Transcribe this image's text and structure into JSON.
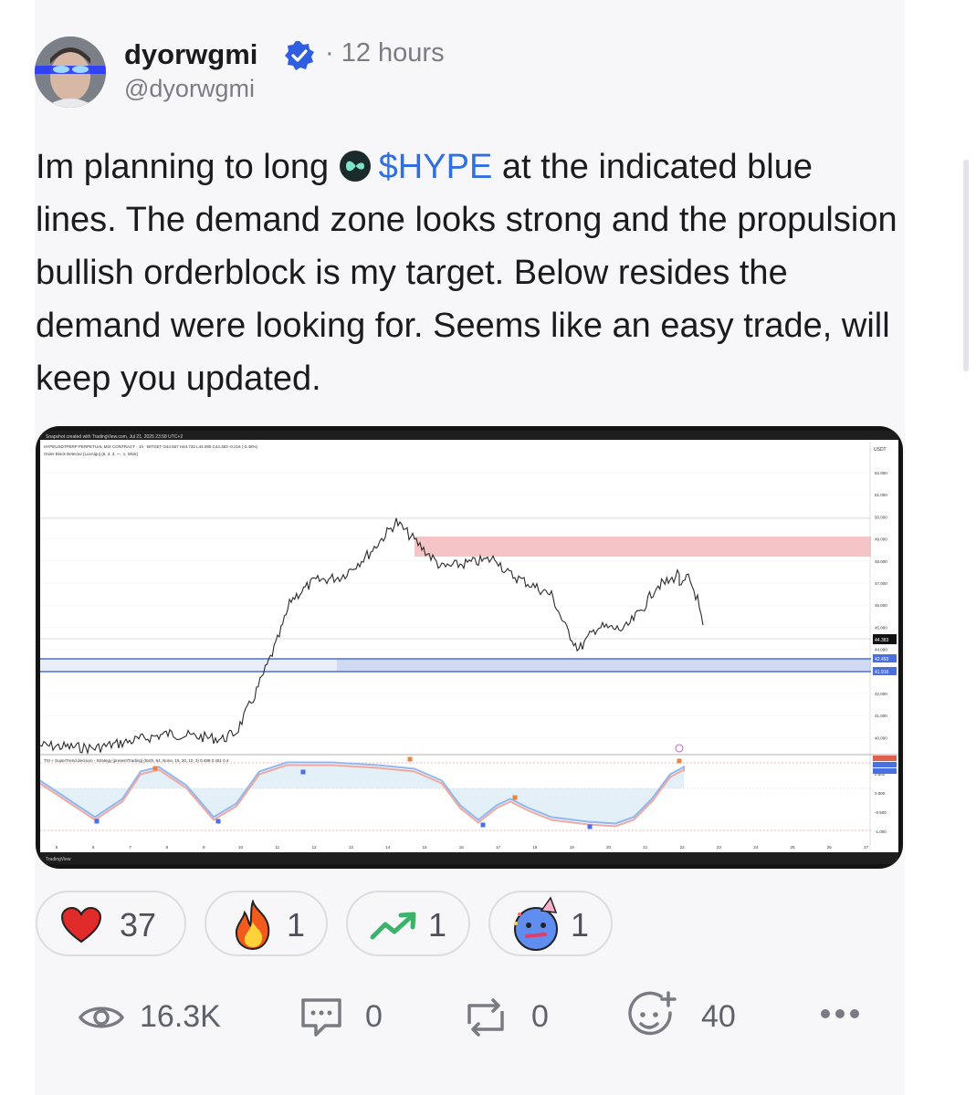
{
  "author": {
    "name": "dyorwgmi",
    "handle": "@dyorwgmi",
    "time": "· 12 hours",
    "verified": true
  },
  "post": {
    "text_before": "Im planning to long",
    "ticker": "$HYPE",
    "text_after": " at the indicated blue lines. The demand zone looks strong and the propulsion bullish orderblock is my target. Below resides the demand were looking for. Seems like an easy trade, will keep you updated.",
    "ticker_color": "#2f6fe0",
    "coin_icon": "hyperliquid-icon"
  },
  "chart_image": {
    "header": "Snapshot created with TradingView.com, Jul 21, 2025 23:58 UTC+2",
    "symbol_line": "HYPEUSDTPERP PERPETUAL MIX CONTRACT · 1h · BITGET O44.567 H44.732 L44.085 C44.383 -0.216 (-0.48%)",
    "indicator_line": "Order Block Detector [LuxAlgo] (5, 3, 3, —, 1, Wick)",
    "oscillator_line": "TSI + SuperTrend decision - Strategy [presentTrading] (Both, 64, None, 16, 20, 10, 3) 0.498 0.451 0.4",
    "currency": "USDT",
    "price_ticks": [
      "52.000",
      "51.000",
      "50.000",
      "49.000",
      "48.000",
      "47.000",
      "46.000",
      "45.000",
      "44.000",
      "43.000",
      "42.000",
      "41.000",
      "40.000"
    ],
    "price_badge": "44.383",
    "blue_badge_1": "42.493",
    "blue_badge_2": "41.916",
    "osc_ticks": [
      "0.500",
      "0.000",
      "-0.500",
      "-1.000"
    ],
    "date_ticks": [
      "5",
      "6",
      "7",
      "8",
      "9",
      "10",
      "11",
      "12",
      "13",
      "14",
      "15",
      "16",
      "17",
      "18",
      "19",
      "20",
      "21",
      "22",
      "23",
      "24",
      "25",
      "26",
      "27"
    ],
    "watermark": "TradingView",
    "demand_zone_color": "#aabbe8",
    "supply_zone_color": "#f2b5b5"
  },
  "reactions": [
    {
      "icon": "heart-icon",
      "count": "37"
    },
    {
      "icon": "fire-icon",
      "count": "1"
    },
    {
      "icon": "trending-up-icon",
      "count": "1"
    },
    {
      "icon": "party-emoji-icon",
      "count": "1"
    }
  ],
  "stats": {
    "views": "16.3K",
    "comments": "0",
    "reposts": "0",
    "emoji_reactions": "40"
  }
}
